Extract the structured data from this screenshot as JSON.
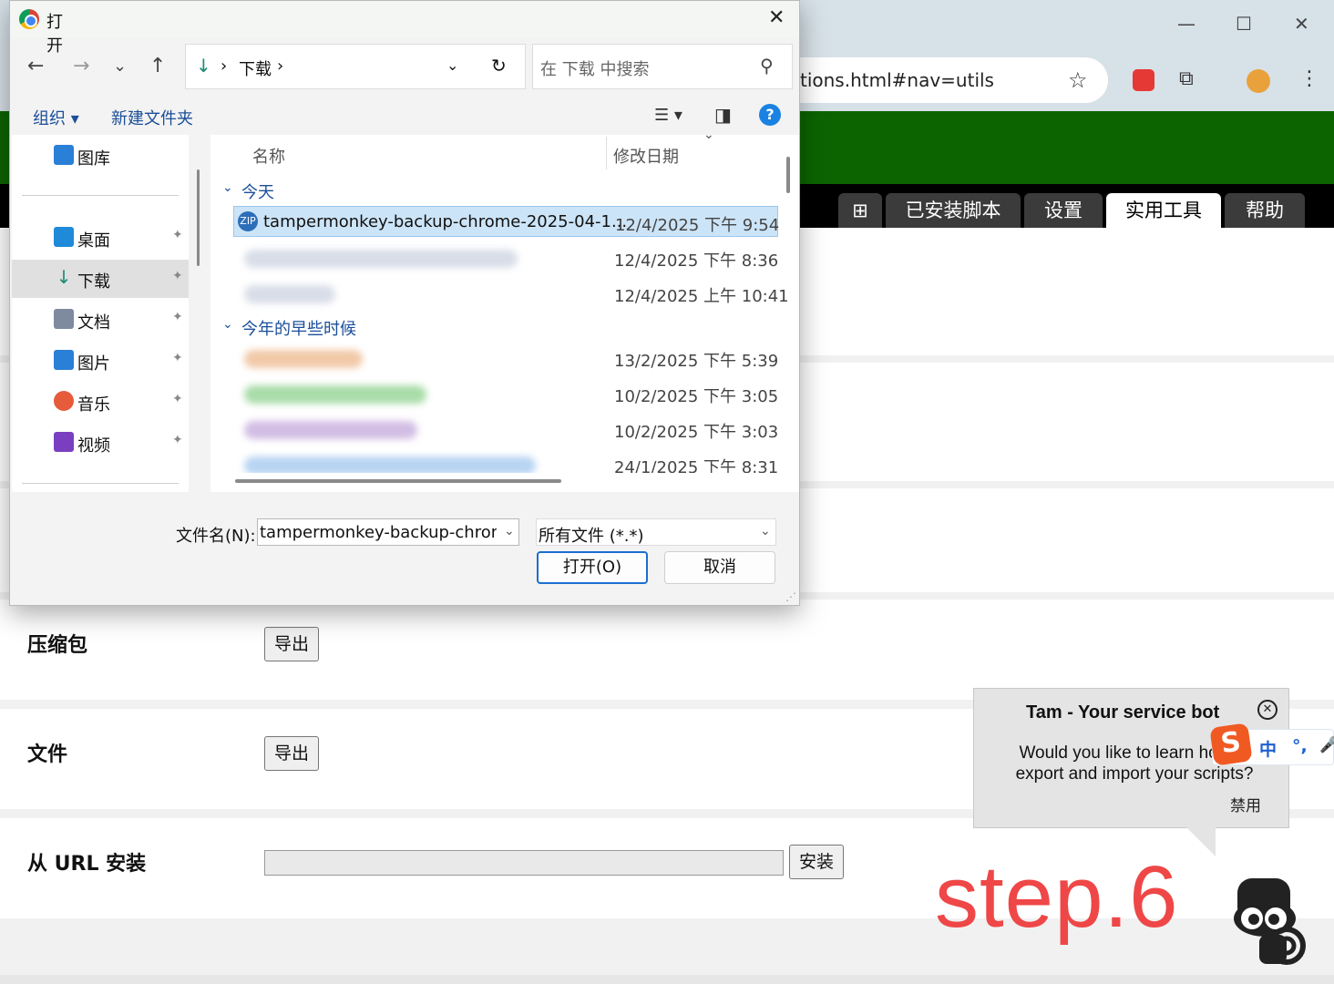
{
  "browser": {
    "url_fragment": "tions.html#nav=utils",
    "win_minimize": "—",
    "win_maximize": "☐",
    "win_close": "✕"
  },
  "tampermonkey": {
    "tabs": [
      {
        "label": "⊞"
      },
      {
        "label": "已安装脚本"
      },
      {
        "label": "设置"
      },
      {
        "label": "实用工具"
      },
      {
        "label": "帮助"
      }
    ],
    "rows": {
      "zip_label": "压缩包",
      "zip_export": "导出",
      "file_label": "文件",
      "file_export": "导出",
      "url_label": "从 URL 安装",
      "url_install": "安装"
    }
  },
  "bot": {
    "title": "Tam - Your service bot",
    "message": "Would you like to learn how to export and import your scripts?",
    "disable": "禁用",
    "close": "✕"
  },
  "ime": {
    "logo": "S",
    "mode": "中",
    "punct": "°,",
    "mic": "🎤"
  },
  "overlay": {
    "step": "step.6"
  },
  "dialog": {
    "title": "打开",
    "close": "✕",
    "nav": {
      "back": "←",
      "forward": "→",
      "recent": "⌄",
      "up": "↑"
    },
    "address": {
      "icon": "↓",
      "sep": "›",
      "folder": "下载",
      "sep2": "›",
      "dropdown": "⌄",
      "refresh": "↻"
    },
    "search_placeholder": "在 下载 中搜索",
    "search_icon": "⚲",
    "cmd": {
      "organize": "组织 ▾",
      "new_folder": "新建文件夹",
      "view_menu": "☰ ▾",
      "preview": "◨",
      "help": "?"
    },
    "nav_pane": [
      {
        "label": "图库",
        "color": "#2a7fd6"
      },
      {
        "label": "桌面",
        "color": "#1f8ad8",
        "pin": "📌"
      },
      {
        "label": "下载",
        "color": "#1b8a74",
        "pin": "📌",
        "selected": true
      },
      {
        "label": "文档",
        "color": "#7d8aa0",
        "pin": "📌"
      },
      {
        "label": "图片",
        "color": "#2a7fd6",
        "pin": "📌"
      },
      {
        "label": "音乐",
        "color": "#e65b3a",
        "pin": "📌"
      },
      {
        "label": "视频",
        "color": "#7a3fc0",
        "pin": "📌"
      }
    ],
    "columns": {
      "name": "名称",
      "modified": "修改日期",
      "sort": "⌄"
    },
    "groups": {
      "today": "今天",
      "earlier": "今年的早些时候",
      "chevron": "⌄"
    },
    "files": [
      {
        "name": "tampermonkey-backup-chrome-2025-04-1...",
        "date": "12/4/2025 下午 9:54",
        "selected": true,
        "icon": "ZIP"
      },
      {
        "name": "",
        "date": "12/4/2025 下午 8:36",
        "blur_color": "#d8dde8"
      },
      {
        "name": "",
        "date": "12/4/2025 上午 10:41",
        "blur_color": "#d8dde8"
      },
      {
        "name": "",
        "date": "13/2/2025 下午 5:39",
        "blur_color": "#f1c9a8"
      },
      {
        "name": "",
        "date": "10/2/2025 下午 3:05",
        "blur_color": "#a8dca8"
      },
      {
        "name": "",
        "date": "10/2/2025 下午 3:03",
        "blur_color": "#d2bde4"
      },
      {
        "name": "",
        "date": "24/1/2025 下午 8:31",
        "blur_color": "#b7d4f2"
      }
    ],
    "filename_label": "文件名(N):",
    "filename_value": "tampermonkey-backup-chrome-",
    "filetype_value": "所有文件 (*.*)",
    "open_button": "打开(O)",
    "cancel_button": "取消",
    "dropdown": "⌄",
    "grip": "⋰"
  }
}
